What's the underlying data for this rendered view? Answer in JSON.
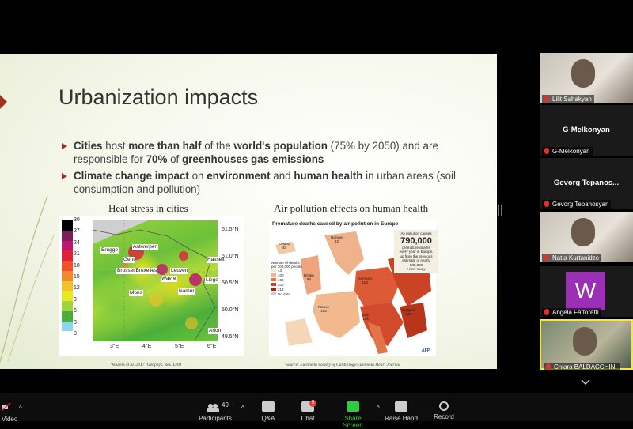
{
  "slide": {
    "title": "Urbanization impacts",
    "bullets": [
      {
        "parts": [
          [
            "b",
            "Cities"
          ],
          [
            "n",
            " host "
          ],
          [
            "b",
            "more than half"
          ],
          [
            "n",
            " of the "
          ],
          [
            "b",
            "world's population"
          ],
          [
            "n",
            " (75% by 2050) and are responsible for "
          ],
          [
            "b",
            "70%"
          ],
          [
            "n",
            " of "
          ],
          [
            "b",
            "greenhouses gas emissions"
          ]
        ]
      },
      {
        "parts": [
          [
            "b",
            "Climate change impact"
          ],
          [
            "n",
            " on "
          ],
          [
            "b",
            "environment"
          ],
          [
            "n",
            " and "
          ],
          [
            "b",
            "human health"
          ],
          [
            "n",
            " in urban areas (soil consumption and pollution)"
          ]
        ]
      }
    ],
    "heat_caption": "Heat stress in cities",
    "heat_source": "Wouters et al. 2017 (Geophys. Res. Lett)",
    "heat_colorbar": [
      "30",
      "27",
      "24",
      "21",
      "18",
      "15",
      "12",
      "9",
      "6",
      "3",
      "0"
    ],
    "heat_colors": [
      "#000000",
      "#7a1f5a",
      "#c0166e",
      "#e0203a",
      "#f0502a",
      "#f08a2a",
      "#f2c22a",
      "#e8e820",
      "#a0d43c",
      "#4cae3a",
      "#8ad8e8",
      "#ffffff"
    ],
    "heat_lat": [
      "51.5°N",
      "51.0°N",
      "50.5°N",
      "50.0°N",
      "49.5°N"
    ],
    "heat_lon": [
      "3°E",
      "4°E",
      "5°E",
      "6°E"
    ],
    "heat_cities": [
      "Brugge",
      "Antwerpen",
      "Gent",
      "Brussel/Bruxelles",
      "Leuven",
      "Hasselt",
      "Wavre",
      "Liège",
      "Mons",
      "Namur",
      "Arlon"
    ],
    "poll_caption": "Air pollution effects on human health",
    "poll_title": "Premature deaths caused by air pollution in Europe",
    "poll_source": "Source: European Society of Cardiology/European Heart Journal",
    "poll_callout_lines": [
      "Air pollution causes",
      "790,000",
      "premature deaths",
      "every year in Europe,",
      "up from the previous",
      "estimate of nearly 535,000",
      ": new study"
    ],
    "poll_legend_title": "Number of deaths per 100,000 people",
    "poll_legend": [
      "43",
      "100",
      "150",
      "200",
      "212",
      "No data"
    ],
    "poll_labels": [
      [
        "Iceland",
        "42"
      ],
      [
        "Norway",
        "42"
      ],
      [
        "Britain",
        "98"
      ],
      [
        "Germany",
        "154"
      ],
      [
        "France",
        "105"
      ],
      [
        "Italy",
        "136"
      ],
      [
        "Bulgaria",
        "315"
      ]
    ],
    "poll_credit": "AFP"
  },
  "participants": [
    {
      "name": "Lilit Sahakyan",
      "type": "video"
    },
    {
      "name": "G-Melkonyan",
      "type": "name",
      "center": "G-Melkonyan"
    },
    {
      "name": "Gevorg Tepanosyan",
      "type": "name",
      "center": "Gevorg Tepanos..."
    },
    {
      "name": "Natia Kurtanidze",
      "type": "video"
    },
    {
      "name": "Angela Fattoretti",
      "type": "avatar",
      "letter": "W"
    },
    {
      "name": "Chiara BALDACCHINI",
      "type": "video"
    }
  ],
  "toolbar": {
    "video": "Video",
    "participants": "Participants",
    "participants_count": "49",
    "qa": "Q&A",
    "chat": "Chat",
    "chat_badge": "5",
    "share": "Share Screen",
    "raise": "Raise Hand",
    "record": "Record"
  },
  "colors": {
    "accent_green": "#2ecc40",
    "badge_red": "#e0403a",
    "bullet_red": "#a0301f",
    "avatar_purple": "#9b2fb5"
  }
}
